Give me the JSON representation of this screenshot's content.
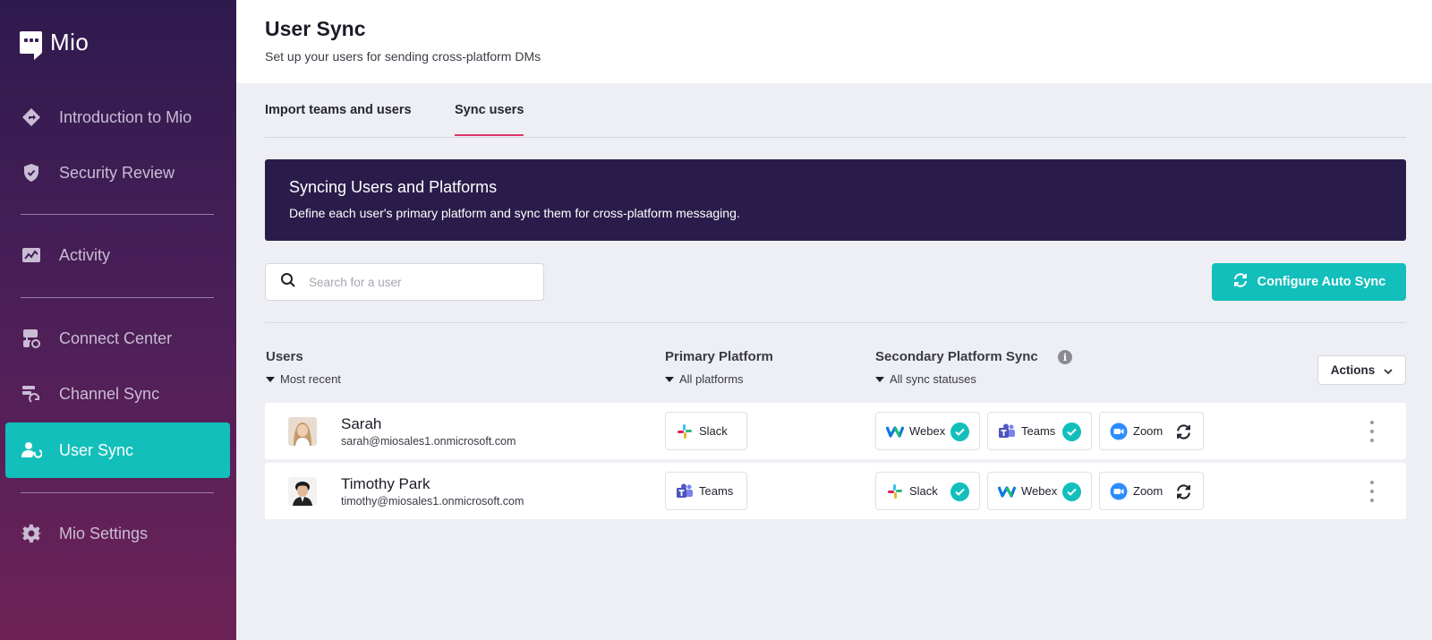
{
  "app": {
    "name": "Mio"
  },
  "sidebar": {
    "items": [
      {
        "label": "Introduction to Mio",
        "icon": "diamond-arrow-icon"
      },
      {
        "label": "Security Review",
        "icon": "shield-icon"
      },
      {
        "label": "Activity",
        "icon": "chart-icon"
      },
      {
        "label": "Connect Center",
        "icon": "connect-icon"
      },
      {
        "label": "Channel Sync",
        "icon": "channel-sync-icon"
      },
      {
        "label": "User Sync",
        "icon": "user-sync-icon",
        "active": true
      },
      {
        "label": "Mio Settings",
        "icon": "gear-icon"
      }
    ]
  },
  "header": {
    "title": "User Sync",
    "subtitle": "Set up your users for sending cross-platform DMs"
  },
  "tabs": [
    {
      "label": "Import teams and users",
      "active": false
    },
    {
      "label": "Sync users",
      "active": true
    }
  ],
  "banner": {
    "title": "Syncing Users and Platforms",
    "text": "Define each user's primary platform and sync them for cross-platform messaging."
  },
  "search": {
    "placeholder": "Search for a user",
    "value": ""
  },
  "auto_sync_button": {
    "label": "Configure Auto Sync"
  },
  "table": {
    "columns": {
      "users": {
        "label": "Users",
        "filter": "Most recent"
      },
      "primary": {
        "label": "Primary Platform",
        "filter": "All platforms"
      },
      "secondary": {
        "label": "Secondary Platform Sync",
        "filter": "All sync statuses",
        "info": "i"
      }
    },
    "actions_label": "Actions",
    "rows": [
      {
        "name": "Sarah",
        "email": "sarah@miosales1.onmicrosoft.com",
        "primary": "Slack",
        "secondary": [
          {
            "platform": "Webex",
            "status": "synced"
          },
          {
            "platform": "Teams",
            "status": "synced"
          },
          {
            "platform": "Zoom",
            "status": "pending"
          }
        ]
      },
      {
        "name": "Timothy Park",
        "email": "timothy@miosales1.onmicrosoft.com",
        "primary": "Teams",
        "secondary": [
          {
            "platform": "Slack",
            "status": "synced"
          },
          {
            "platform": "Webex",
            "status": "synced"
          },
          {
            "platform": "Zoom",
            "status": "pending"
          }
        ]
      }
    ]
  },
  "colors": {
    "accent": "#12bfbb",
    "tab_underline": "#e0356a",
    "banner_bg": "#2a1c4a",
    "sidebar_top": "#2e1a4d",
    "sidebar_bottom": "#6d2257"
  }
}
